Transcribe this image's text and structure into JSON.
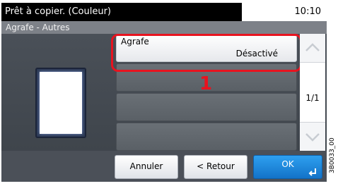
{
  "status": {
    "message": "Prêt à copier. (Couleur)",
    "time": "10:10"
  },
  "breadcrumb": "Agrafe - Autres",
  "options": [
    {
      "label": "Agrafe",
      "value": "Désactivé"
    }
  ],
  "pager": {
    "page": "1/1"
  },
  "callout": {
    "number": "1"
  },
  "buttons": {
    "cancel": "Annuler",
    "back": "< Retour",
    "ok": "OK"
  },
  "caption": "3B0033_00",
  "colors": {
    "callout": "#e8131f",
    "ok_button": "#1f8ee0"
  }
}
